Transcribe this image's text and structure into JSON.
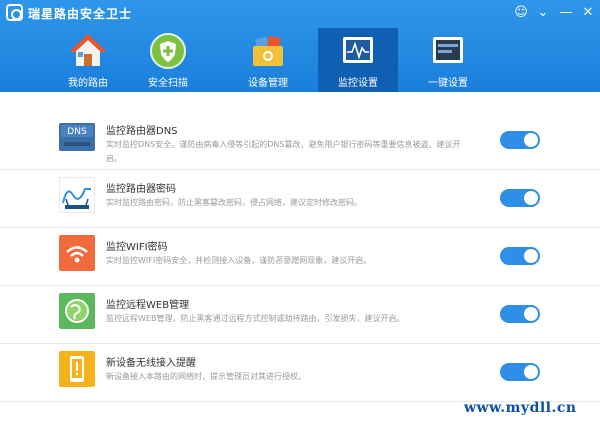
{
  "app": {
    "title": "瑞星路由安全卫士"
  },
  "window_controls": {
    "user": "☺",
    "menu": "⌄",
    "minimize": "—",
    "close": "✕"
  },
  "tabs": [
    {
      "label": "我的路由",
      "icon": "house-icon",
      "active": false
    },
    {
      "label": "安全扫描",
      "icon": "shield-icon",
      "active": false
    },
    {
      "label": "设备管理",
      "icon": "device-box-icon",
      "active": false
    },
    {
      "label": "监控设置",
      "icon": "monitor-icon",
      "active": true
    },
    {
      "label": "一键设置",
      "icon": "router-settings-icon",
      "active": false
    }
  ],
  "items": [
    {
      "title": "监控路由器DNS",
      "desc": "实时监控DNS安全。谨防由病毒入侵等引起的DNS篡改，避免用户银行密码等重要信息被盗，建议开启。",
      "icon": "dns-icon",
      "icon_color": "#3b6fa8",
      "enabled": true
    },
    {
      "title": "监控路由器密码",
      "desc": "实时监控路由密码，防止黑客篡改密码，侵占网络，建议定时修改密码。",
      "icon": "router-password-icon",
      "icon_color": "#ffffff",
      "enabled": true
    },
    {
      "title": "监控WIFI密码",
      "desc": "实时监控WIFI密码安全，并检测接入设备，谨防恶意蹭网现象，建议开启。",
      "icon": "wifi-icon",
      "icon_color": "#f06a3c",
      "enabled": true
    },
    {
      "title": "监控远程WEB管理",
      "desc": "监控远程WEB管理，防止黑客通过远程方式控制或劫持路由，引发损失，建议开启。",
      "icon": "globe-icon",
      "icon_color": "#5cb85c",
      "enabled": true
    },
    {
      "title": "新设备无线接入提醒",
      "desc": "新设备接入本路由的网络时，提示管理员对其进行授权。",
      "icon": "phone-alert-icon",
      "icon_color": "#f5b21a",
      "enabled": true
    }
  ],
  "watermark": "www.mydll.cn",
  "colors": {
    "header": "#1a7fdb",
    "active_tab": "#0f5fb3",
    "toggle_on": "#2f8fe6"
  }
}
